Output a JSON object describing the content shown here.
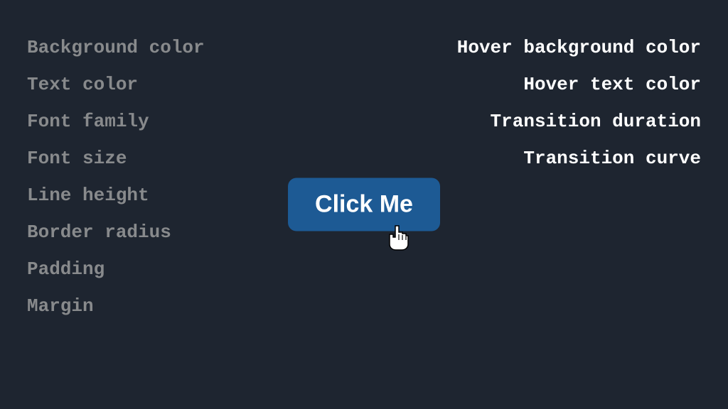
{
  "left_properties": [
    "Background color",
    "Text color",
    "Font family",
    "Font size",
    "Line height",
    "Border radius",
    "Padding",
    "Margin"
  ],
  "right_properties": [
    "Hover background color",
    "Hover text color",
    "Transition duration",
    "Transition curve"
  ],
  "button": {
    "label": "Click Me"
  },
  "colors": {
    "background": "#1e2530",
    "left_text": "#888a8c",
    "right_text": "#ffffff",
    "button_bg": "#1d5a94",
    "button_text": "#ffffff"
  }
}
